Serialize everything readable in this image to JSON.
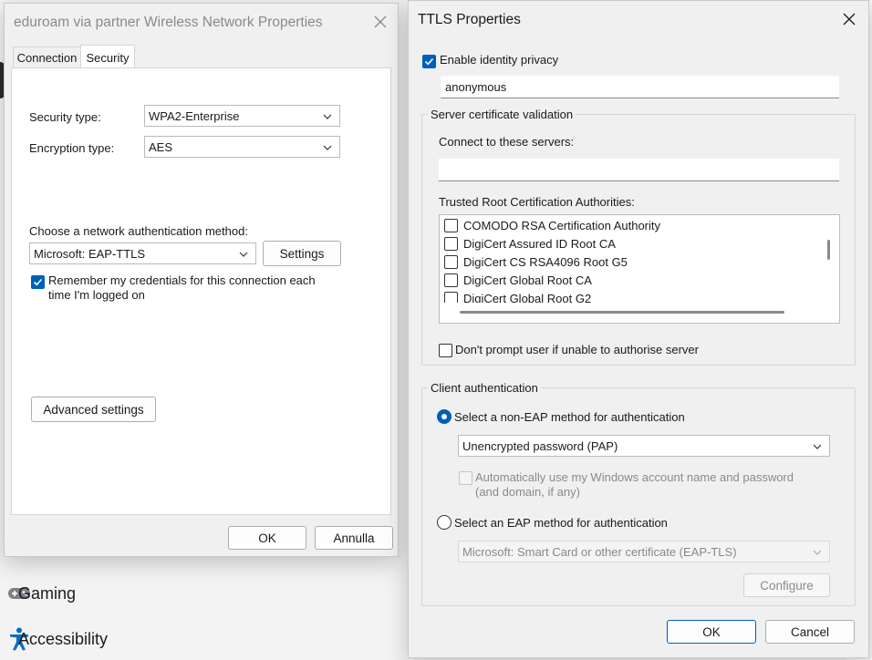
{
  "background": {
    "nav": [
      {
        "label": "Gaming",
        "icon": "gamepad-icon"
      },
      {
        "label": "Accessibility",
        "icon": "accessibility-icon"
      }
    ]
  },
  "network_dialog": {
    "title": "eduroam via partner Wireless Network Properties",
    "tabs": [
      "Connection",
      "Security"
    ],
    "active_tab": "Security",
    "security_type_label": "Security type:",
    "security_type_value": "WPA2-Enterprise",
    "encryption_type_label": "Encryption type:",
    "encryption_type_value": "AES",
    "auth_method_label": "Choose a network authentication method:",
    "auth_method_value": "Microsoft: EAP-TTLS",
    "settings_button": "Settings",
    "remember_line1": "Remember my credentials for this connection each",
    "remember_line2": "time I'm logged on",
    "remember_checked": true,
    "advanced_button": "Advanced settings",
    "ok_button": "OK",
    "cancel_button": "Annulla"
  },
  "ttls_dialog": {
    "title": "TTLS Properties",
    "identity_privacy_label": "Enable identity privacy",
    "identity_privacy_checked": true,
    "identity_value": "anonymous",
    "server_validation_title": "Server certificate validation",
    "connect_servers_label": "Connect to these servers:",
    "connect_servers_value": "",
    "trusted_root_label": "Trusted Root Certification Authorities:",
    "certificates": [
      {
        "name": "COMODO RSA Certification Authority",
        "checked": false
      },
      {
        "name": "DigiCert Assured ID Root CA",
        "checked": false
      },
      {
        "name": "DigiCert CS RSA4096 Root G5",
        "checked": false
      },
      {
        "name": "DigiCert Global Root CA",
        "checked": false
      },
      {
        "name": "DigiCert Global Root G2",
        "checked": false
      }
    ],
    "dont_prompt_label": "Don't prompt user if unable to authorise server",
    "dont_prompt_checked": false,
    "client_auth_title": "Client authentication",
    "non_eap_label": "Select a non-EAP method for authentication",
    "non_eap_selected": true,
    "non_eap_method_value": "Unencrypted password (PAP)",
    "auto_windows_line1": "Automatically use my Windows account name and password",
    "auto_windows_line2": "(and domain, if any)",
    "eap_label": "Select an EAP method for authentication",
    "eap_method_value": "Microsoft: Smart Card or other certificate (EAP-TLS)",
    "configure_button": "Configure",
    "ok_button": "OK",
    "cancel_button": "Cancel",
    "accent_color": "#005fb8"
  }
}
